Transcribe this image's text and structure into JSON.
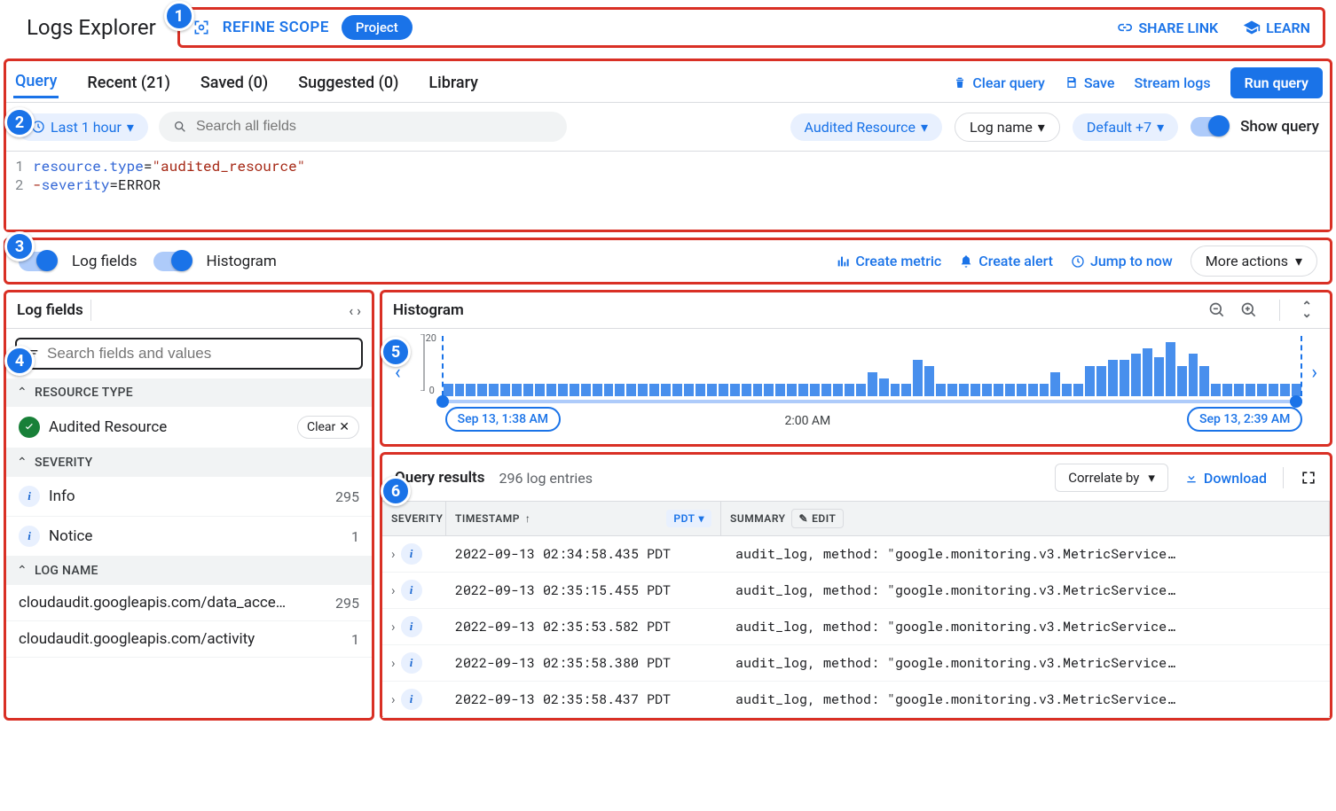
{
  "header": {
    "title": "Logs Explorer",
    "refine_label": "REFINE SCOPE",
    "scope_pill": "Project",
    "share_link": "SHARE LINK",
    "learn": "LEARN"
  },
  "annotations": [
    "1",
    "2",
    "3",
    "4",
    "5",
    "6"
  ],
  "tabs": {
    "query": "Query",
    "recent": "Recent (21)",
    "saved": "Saved (0)",
    "suggested": "Suggested (0)",
    "library": "Library"
  },
  "actions": {
    "clear_query": "Clear query",
    "save": "Save",
    "stream_logs": "Stream logs",
    "run_query": "Run query"
  },
  "filters": {
    "time": "Last 1 hour",
    "search_placeholder": "Search all fields",
    "resource": "Audited Resource",
    "log_name": "Log name",
    "severity": "Default +7",
    "show_query": "Show query"
  },
  "editor": {
    "l1_key": "resource.type",
    "l1_val": "\"audited_resource\"",
    "l2_neg": "-",
    "l2_key": "severity",
    "l2_val": "ERROR"
  },
  "midbar": {
    "log_fields": "Log fields",
    "histogram": "Histogram",
    "create_metric": "Create metric",
    "create_alert": "Create alert",
    "jump_now": "Jump to now",
    "more": "More actions"
  },
  "log_fields": {
    "title": "Log fields",
    "search_placeholder": "Search fields and values",
    "group_resource": "RESOURCE TYPE",
    "resource_item": "Audited Resource",
    "clear": "Clear",
    "group_severity": "SEVERITY",
    "sev_info": "Info",
    "sev_info_n": "295",
    "sev_notice": "Notice",
    "sev_notice_n": "1",
    "group_logname": "LOG NAME",
    "ln1": "cloudaudit.googleapis.com/data_acce…",
    "ln1_n": "295",
    "ln2": "cloudaudit.googleapis.com/activity",
    "ln2_n": "1"
  },
  "histogram": {
    "title": "Histogram",
    "ymax": "20",
    "ymin": "0",
    "start": "Sep 13, 1:38 AM",
    "mid": "2:00 AM",
    "end": "Sep 13, 2:39 AM"
  },
  "chart_data": {
    "type": "bar",
    "title": "Histogram",
    "ylabel": "",
    "ylim": [
      0,
      20
    ],
    "x_range": [
      "Sep 13, 1:38 AM",
      "Sep 13, 2:39 AM"
    ],
    "tick_labels": [
      "2:00 AM"
    ],
    "values": [
      4,
      4,
      4,
      4,
      4,
      4,
      4,
      4,
      4,
      4,
      4,
      4,
      4,
      4,
      4,
      4,
      4,
      4,
      4,
      4,
      4,
      4,
      4,
      4,
      4,
      4,
      4,
      4,
      4,
      4,
      4,
      4,
      4,
      4,
      4,
      4,
      4,
      8,
      6,
      4,
      4,
      12,
      10,
      4,
      4,
      4,
      4,
      4,
      4,
      4,
      4,
      4,
      4,
      8,
      4,
      4,
      10,
      10,
      12,
      12,
      14,
      16,
      13,
      18,
      10,
      14,
      10,
      4,
      4,
      4,
      4,
      4,
      4,
      4,
      4
    ]
  },
  "results": {
    "title": "Query results",
    "count": "296 log entries",
    "correlate": "Correlate by",
    "download": "Download",
    "col_sev": "SEVERITY",
    "col_ts": "TIMESTAMP",
    "tz": "PDT",
    "col_sum": "SUMMARY",
    "edit": "EDIT",
    "rows": [
      {
        "ts": "2022-09-13 02:34:58.435 PDT",
        "sum": "audit_log, method: \"google.monitoring.v3.MetricService…"
      },
      {
        "ts": "2022-09-13 02:35:15.455 PDT",
        "sum": "audit_log, method: \"google.monitoring.v3.MetricService…"
      },
      {
        "ts": "2022-09-13 02:35:53.582 PDT",
        "sum": "audit_log, method: \"google.monitoring.v3.MetricService…"
      },
      {
        "ts": "2022-09-13 02:35:58.380 PDT",
        "sum": "audit_log, method: \"google.monitoring.v3.MetricService…"
      },
      {
        "ts": "2022-09-13 02:35:58.437 PDT",
        "sum": "audit_log, method: \"google.monitoring.v3.MetricService…"
      }
    ]
  }
}
